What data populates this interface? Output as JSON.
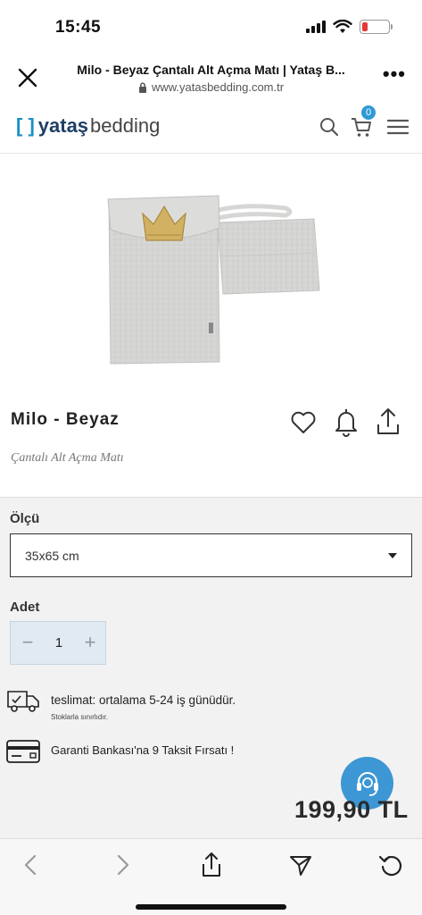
{
  "status_bar": {
    "time": "15:45",
    "battery_color": "#e53935"
  },
  "browser": {
    "page_title": "Milo - Beyaz Çantalı Alt Açma Matı | Yataş B...",
    "url": "www.yatasbedding.com.tr",
    "more_label": "•••"
  },
  "site_header": {
    "logo_bracket": "[ ]",
    "logo_brand": "yataş",
    "logo_sub": "bedding",
    "cart_count": "0",
    "accent_color": "#2e9ad6"
  },
  "product": {
    "name": "Milo - Beyaz",
    "subtitle": "Çantalı Alt Açma Matı"
  },
  "options": {
    "size_label": "Ölçü",
    "size_value": "35x65 cm",
    "quantity_label": "Adet",
    "quantity_value": "1",
    "minus_label": "−",
    "plus_label": "+"
  },
  "info": {
    "delivery_text": "teslimat: ortalama 5-24 iş günüdür.",
    "stock_note": "Stoklarla sınırlıdır.",
    "installment_text": "Garanti Bankası'na 9 Taksit Fırsatı !"
  },
  "price": "199,90 TL",
  "icons": {
    "close": "close-icon",
    "lock": "lock-icon",
    "search": "search-icon",
    "cart": "cart-icon",
    "menu": "menu-icon",
    "heart": "heart-icon",
    "bell": "bell-icon",
    "share": "share-icon",
    "delivery": "truck-icon",
    "card": "credit-card-icon",
    "support": "headset-icon",
    "back": "back-icon",
    "forward": "forward-icon",
    "send": "send-icon",
    "reload": "reload-icon"
  }
}
